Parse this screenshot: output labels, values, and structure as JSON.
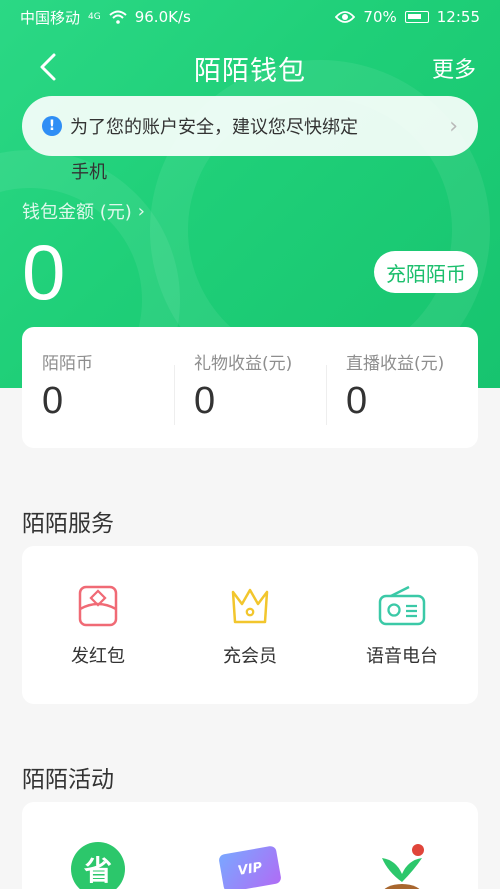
{
  "status_bar": {
    "carrier": "中国移动",
    "network": "4G",
    "speed": "96.0K/s",
    "battery": "70%",
    "time": "12:55"
  },
  "nav": {
    "title": "陌陌钱包",
    "more": "更多"
  },
  "notice": {
    "text_line1": "为了您的账户安全，建议您尽快绑定",
    "text_line2": "手机"
  },
  "wallet": {
    "balance_label": "钱包金额 (元)",
    "balance": "0",
    "recharge_button": "充陌陌币"
  },
  "stats": [
    {
      "label": "陌陌币",
      "value": "0"
    },
    {
      "label": "礼物收益(元)",
      "value": "0"
    },
    {
      "label": "直播收益(元)",
      "value": "0"
    }
  ],
  "services": {
    "title": "陌陌服务",
    "items": [
      {
        "label": "发红包",
        "icon": "red-envelope-icon"
      },
      {
        "label": "充会员",
        "icon": "crown-icon"
      },
      {
        "label": "语音电台",
        "icon": "radio-icon"
      }
    ]
  },
  "activities": {
    "title": "陌陌活动",
    "items": [
      {
        "badge": "省",
        "icon": "save-money-icon"
      },
      {
        "badge": "VIP",
        "icon": "vip-card-icon"
      },
      {
        "icon": "sprout-icon"
      }
    ]
  },
  "colors": {
    "brand_green": "#1fcf78",
    "info_blue": "#2f8ef5",
    "envelope_red": "#f06a75",
    "crown_yellow": "#f2c62d",
    "radio_teal": "#3bc9a7"
  }
}
